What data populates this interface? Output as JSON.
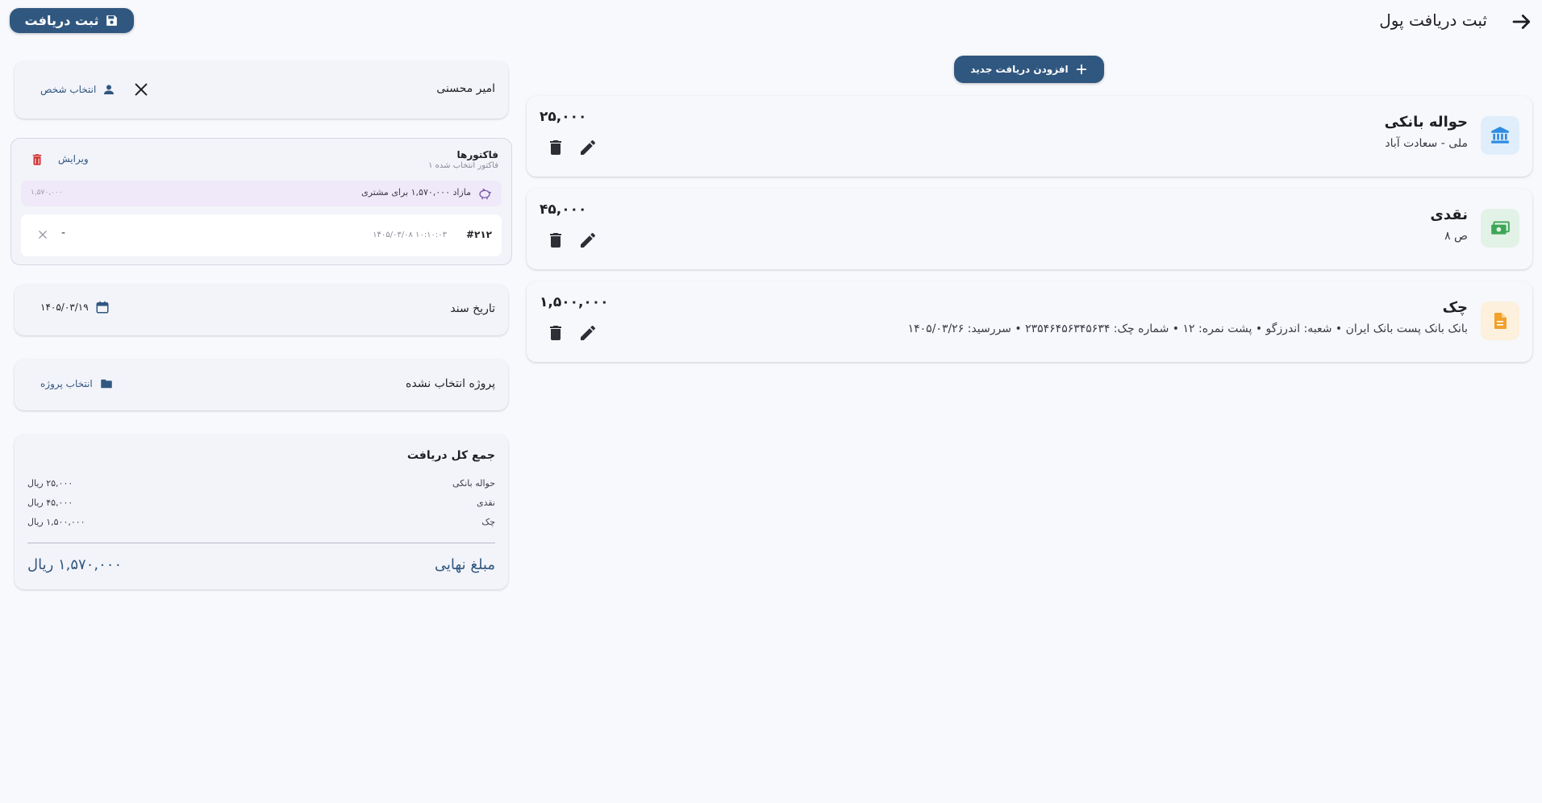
{
  "header": {
    "title": "ثبت دریافت پول",
    "save_label": "ثبت دریافت",
    "add_label": "افزودن دریافت جدید"
  },
  "payments": [
    {
      "title": "حواله بانکی",
      "subtitle": "ملی - سعادت آباد",
      "amount": "۲۵,۰۰۰",
      "icon": "bank-icon",
      "icon_bg": "#e0eefc",
      "icon_color": "#2f8ce0"
    },
    {
      "title": "نقدی",
      "subtitle": "ص ۸",
      "amount": "۴۵,۰۰۰",
      "icon": "cash-icon",
      "icon_bg": "#e2f2e6",
      "icon_color": "#3fa557"
    },
    {
      "title": "چک",
      "subtitle": "بانک بانک پست بانک ایران • شعبه: اندرزگو • پشت نمره: ۱۲ • شماره چک: ۲۳۵۴۶۴۵۶۳۴۵۶۳۴ • سررسید: ۱۴۰۵/۰۳/۲۶",
      "amount": "۱,۵۰۰,۰۰۰",
      "icon": "check-document-icon",
      "icon_bg": "#fdf0dc",
      "icon_color": "#f2a12b"
    }
  ],
  "person": {
    "name": "امیر محسنی",
    "select_label": "انتخاب شخص"
  },
  "invoices": {
    "title": "فاکتورها",
    "subtitle": "۱ فاکتور انتخاب شده",
    "edit_label": "ویرایش",
    "surplus_text": "مازاد ۱,۵۷۰,۰۰۰ برای مشتری",
    "surplus_amount": "۱,۵۷۰,۰۰۰",
    "items": [
      {
        "number": "#۲۱۲",
        "datetime": "۱۴۰۵/۰۳/۰۸ ۱۰:۱۰:۰۳",
        "amount": "-"
      }
    ]
  },
  "doc_date": {
    "label": "تاریخ سند",
    "value": "۱۴۰۵/۰۳/۱۹"
  },
  "project": {
    "label": "پروژه انتخاب نشده",
    "select_label": "انتخاب پروژه"
  },
  "summary": {
    "title": "جمع کل دریافت",
    "rows": [
      {
        "label": "حواله بانکی",
        "value": "۲۵,۰۰۰ ریال"
      },
      {
        "label": "نقدی",
        "value": "۴۵,۰۰۰ ریال"
      },
      {
        "label": "چک",
        "value": "۱,۵۰۰,۰۰۰ ریال"
      }
    ],
    "final_label": "مبلغ نهایی",
    "final_value": "۱,۵۷۰,۰۰۰ ریال"
  },
  "colors": {
    "primary": "#30577f",
    "background": "#f8f9fd",
    "danger": "#d32f2f",
    "surplus_bg": "#f0e9f9"
  }
}
